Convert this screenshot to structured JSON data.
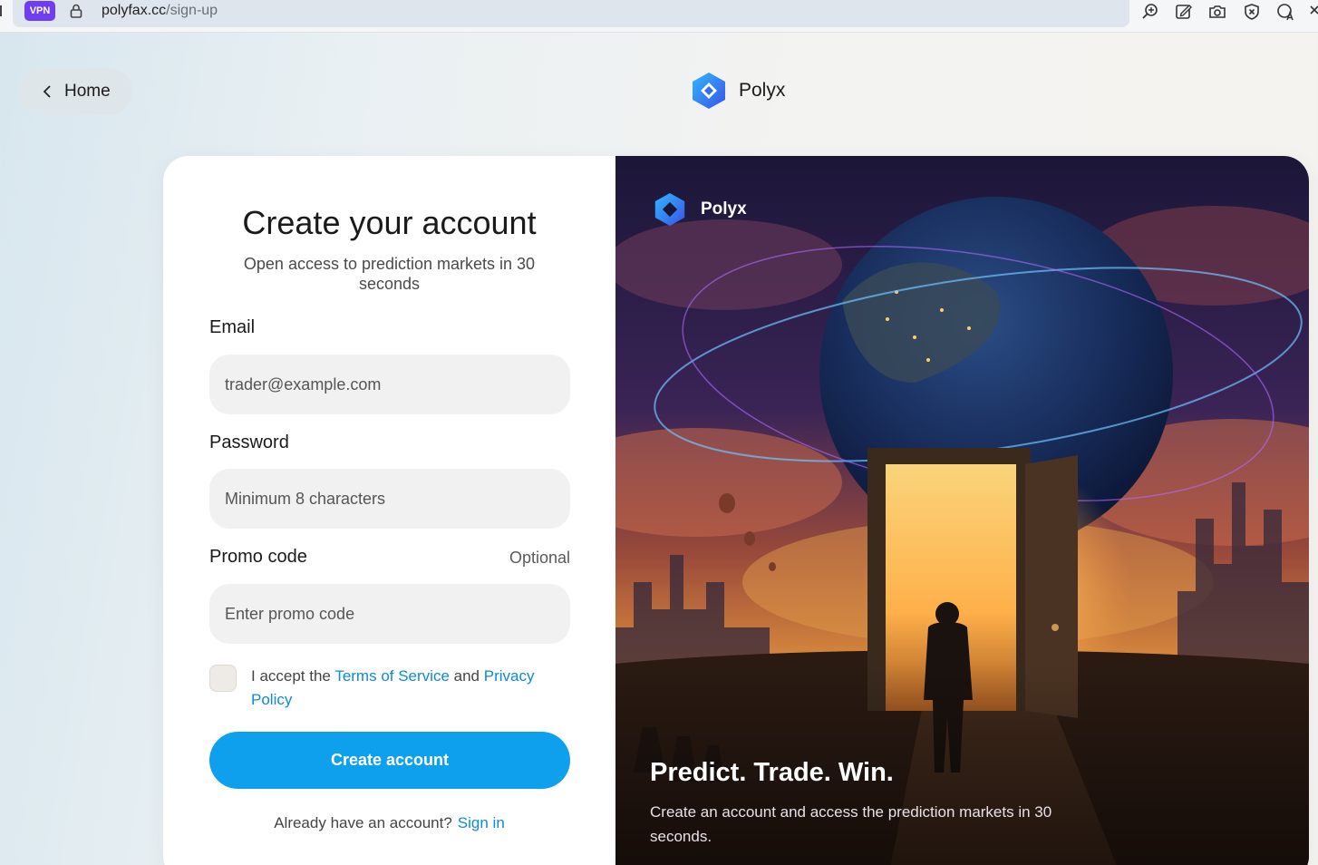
{
  "browser": {
    "vpn_label": "VPN",
    "url_host": "polyfax.cc",
    "url_path": "/sign-up"
  },
  "nav": {
    "home_label": "Home",
    "brand_name": "Polyx"
  },
  "form": {
    "title": "Create your account",
    "subtitle": "Open access to prediction markets in 30 seconds",
    "email_label": "Email",
    "email_placeholder": "trader@example.com",
    "password_label": "Password",
    "password_placeholder": "Minimum 8 characters",
    "promo_label": "Promo code",
    "promo_optional": "Optional",
    "promo_placeholder": "Enter promo code",
    "terms_prefix": "I accept the",
    "terms_link": "Terms of Service",
    "terms_and": "and",
    "privacy_link": "Privacy Policy",
    "submit_label": "Create account",
    "signin_prompt": "Already have an account?",
    "signin_link": "Sign in"
  },
  "hero": {
    "brand_name": "Polyx",
    "headline": "Predict. Trade. Win.",
    "description": "Create an account and access the prediction markets in 30 seconds."
  },
  "colors": {
    "accent": "#0ea0ec",
    "link": "#0d8ad8",
    "vpn_badge": "#6d3ef2"
  }
}
